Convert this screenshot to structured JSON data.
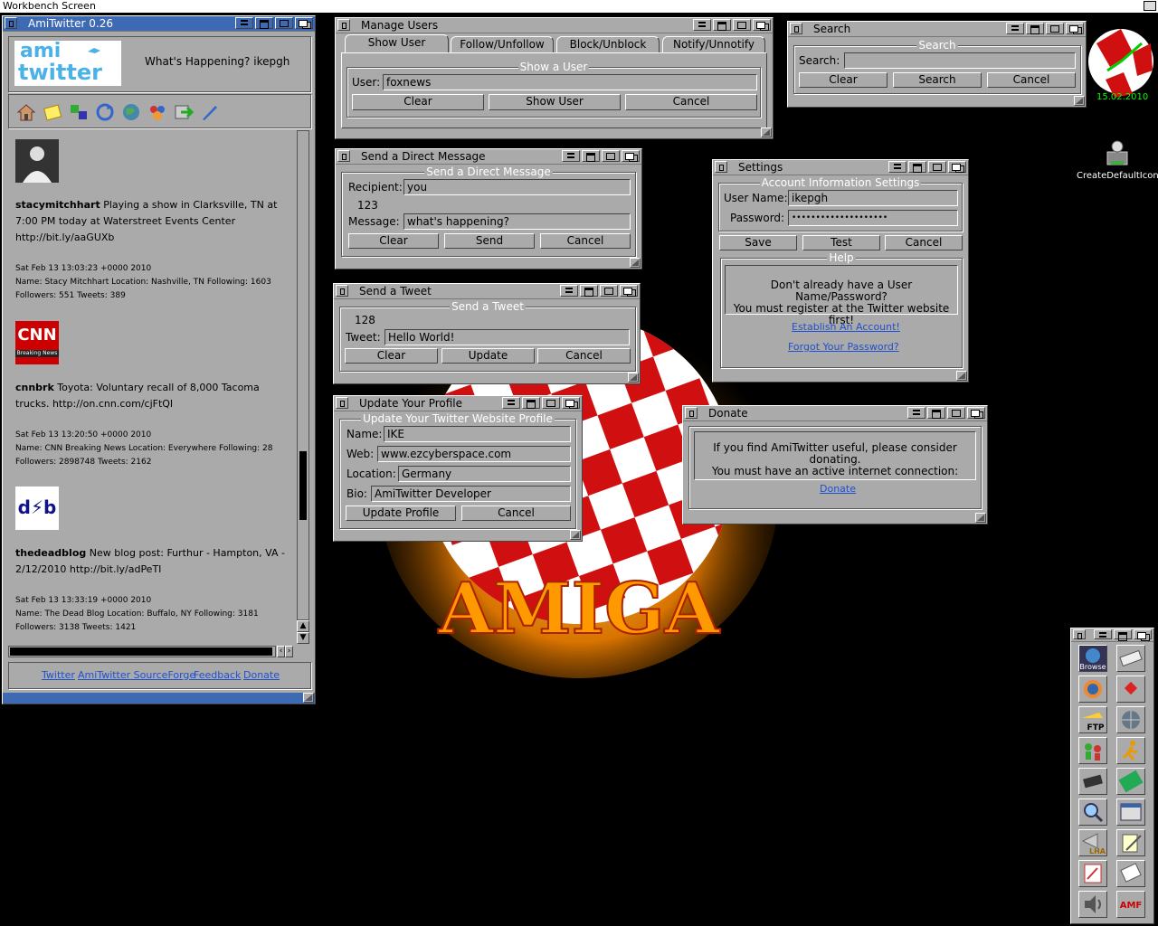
{
  "screen": {
    "title": "Workbench Screen"
  },
  "amitwitter": {
    "title": "AmiTwitter 0.26",
    "logo_top": "ami",
    "logo_bottom": "twitter",
    "status": "What's Happening?  ikepgh",
    "toolbar": [
      "home-icon",
      "notes-icon",
      "network-icon",
      "refresh-icon",
      "globe-icon",
      "users-icon",
      "forward-icon",
      "pen-icon"
    ],
    "tweets": [
      {
        "user": "stacymitchhart",
        "text": "Playing a show in Clarksville, TN at 7:00 PM today at Waterstreet Events Center http://bit.ly/aaGUXb",
        "date": "Sat Feb 13 13:03:23 +0000 2010",
        "info": "Name: Stacy Mitchhart Location: Nashville, TN Following: 1603",
        "stats": "Followers: 551 Tweets: 389"
      },
      {
        "user": "cnnbrk",
        "text": "Toyota: Voluntary recall of 8,000 Tacoma trucks. http://on.cnn.com/cjFtQI",
        "date": "Sat Feb 13 13:20:50 +0000 2010",
        "info": "Name: CNN Breaking News Location: Everywhere Following: 28",
        "stats": "Followers: 2898748 Tweets: 2162",
        "avatar_text": "CNN",
        "avatar_sub": "Breaking News"
      },
      {
        "user": "thedeadblog",
        "text": "New blog post: Furthur - Hampton, VA - 2/12/2010 http://bit.ly/adPeTI",
        "date": "Sat Feb 13 13:33:19 +0000 2010",
        "info": "Name: The Dead Blog Location: Buffalo, NY Following: 3181",
        "stats": "Followers: 3138 Tweets: 1421",
        "avatar_text": "d⚡b"
      }
    ],
    "links": [
      "Twitter",
      "AmiTwitter SourceForge",
      "Feedback",
      "Donate"
    ]
  },
  "manage_users": {
    "title": "Manage Users",
    "tabs": [
      "Show User",
      "Follow/Unfollow",
      "Block/Unblock",
      "Notify/Unnotify"
    ],
    "group_title": "Show a User",
    "user_label": "User:",
    "user_value": "foxnews",
    "buttons": [
      "Clear",
      "Show User",
      "Cancel"
    ]
  },
  "search": {
    "title": "Search",
    "group_title": "Search",
    "search_label": "Search:",
    "search_value": "",
    "buttons": [
      "Clear",
      "Search",
      "Cancel"
    ]
  },
  "direct_message": {
    "title": "Send a Direct Message",
    "group_title": "Send a Direct Message",
    "recipient_label": "Recipient:",
    "recipient_value": "you",
    "counter": "123",
    "message_label": "Message:",
    "message_value": "what's happening?",
    "buttons": [
      "Clear",
      "Send",
      "Cancel"
    ]
  },
  "settings": {
    "title": "Settings",
    "group_title": "Account Information Settings",
    "username_label": "User Name:",
    "username_value": "ikepgh",
    "password_label": "Password:",
    "password_value": "••••••••••••••••••••",
    "buttons": [
      "Save",
      "Test",
      "Cancel"
    ],
    "help_title": "Help",
    "help_text_1": "Don't already have a User Name/Password?",
    "help_text_2": "You must register at the Twitter website first!",
    "link_establish": "Establish An Account!",
    "link_forgot": "Forgot Your Password?"
  },
  "send_tweet": {
    "title": "Send a Tweet",
    "group_title": "Send a Tweet",
    "counter": "128",
    "tweet_label": "Tweet:",
    "tweet_value": "Hello World!",
    "buttons": [
      "Clear",
      "Update",
      "Cancel"
    ]
  },
  "update_profile": {
    "title": "Update Your Profile",
    "group_title": "Update Your Twitter Website Profile",
    "name_label": "Name:",
    "name_value": "IKE",
    "web_label": "Web:",
    "web_value": "www.ezcyberspace.com",
    "location_label": "Location:",
    "location_value": "Germany",
    "bio_label": "Bio:",
    "bio_value": "AmiTwitter Developer",
    "buttons": [
      "Update Profile",
      "Cancel"
    ]
  },
  "donate": {
    "title": "Donate",
    "text_1": "If you find AmiTwitter useful, please consider donating.",
    "text_2": "You must have an active internet connection:",
    "link": "Donate"
  },
  "desktop": {
    "clock_date": "15.02.2010",
    "icon_label": "CreateDefaultIcon",
    "wallpaper_text": "AMIGA"
  },
  "dock": {
    "icons": [
      "browse-icon",
      "keyboard-icon",
      "world-icon",
      "gem-icon",
      "ftp-icon",
      "network-globe-icon",
      "people-icon",
      "runner-icon",
      "chip-icon",
      "circuit-board-icon",
      "magnifier-icon",
      "window-icon",
      "lha-icon",
      "notepad-icon",
      "paint-icon",
      "document-icon",
      "speaker-icon",
      "amf-icon"
    ],
    "labels": {
      "browse": "Browse",
      "ftp": "FTP",
      "lha": "LHA",
      "amf": "AMF"
    }
  },
  "colors": {
    "window_bg": "#aaaaaa",
    "active_title": "#3e6ab3",
    "link": "#2050d0",
    "desktop": "#000000"
  }
}
